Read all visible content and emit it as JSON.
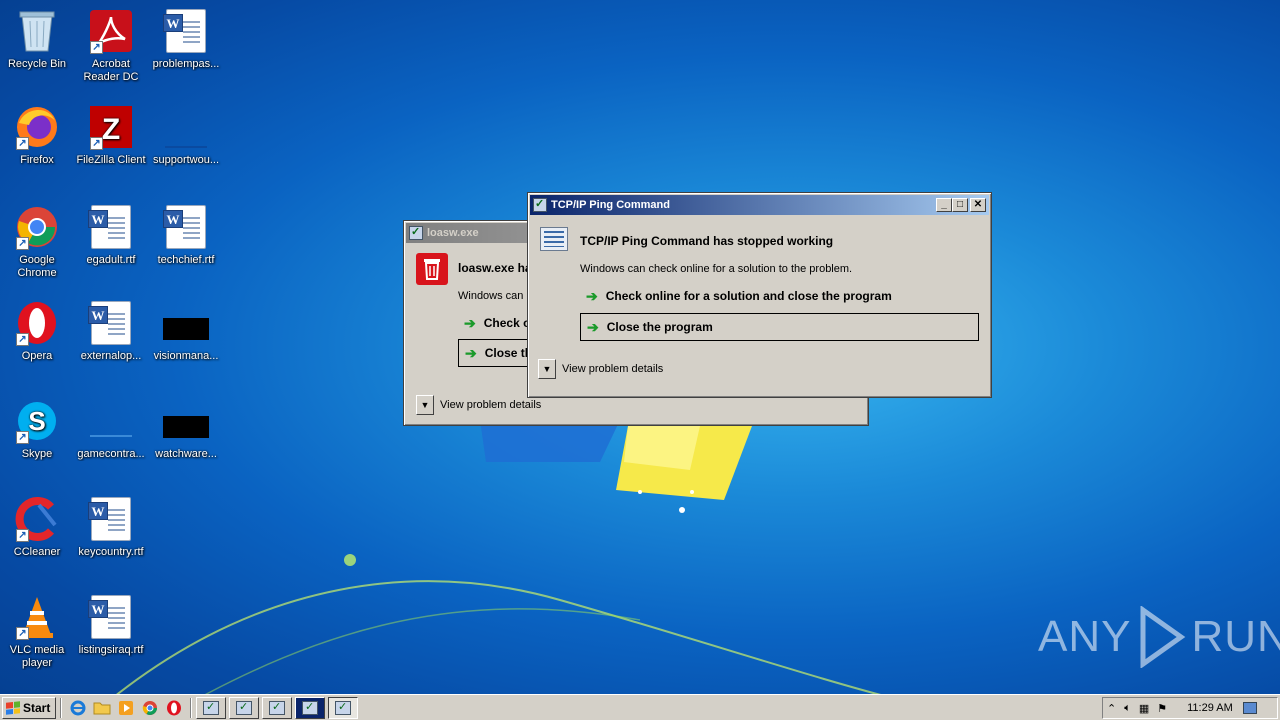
{
  "desktop": {
    "icons": [
      {
        "label": "Recycle Bin",
        "icon": "recycle-bin-icon"
      },
      {
        "label": "Acrobat Reader DC",
        "icon": "acrobat-icon"
      },
      {
        "label": "problempas...",
        "icon": "word-doc-icon"
      },
      {
        "label": "Firefox",
        "icon": "firefox-icon"
      },
      {
        "label": "FileZilla Client",
        "icon": "filezilla-icon"
      },
      {
        "label": "supportwou...",
        "icon": "blank-file-icon"
      },
      {
        "label": "Google Chrome",
        "icon": "chrome-icon"
      },
      {
        "label": "egadult.rtf",
        "icon": "word-doc-icon"
      },
      {
        "label": "techchief.rtf",
        "icon": "word-doc-icon"
      },
      {
        "label": "Opera",
        "icon": "opera-icon"
      },
      {
        "label": "externalop...",
        "icon": "word-doc-icon"
      },
      {
        "label": "visionmana...",
        "icon": "black-file-icon"
      },
      {
        "label": "Skype",
        "icon": "skype-icon"
      },
      {
        "label": "gamecontra...",
        "icon": "blank-file-icon"
      },
      {
        "label": "watchware...",
        "icon": "black-file-icon"
      },
      {
        "label": "CCleaner",
        "icon": "ccleaner-icon"
      },
      {
        "label": "keycountry.rtf",
        "icon": "word-doc-icon"
      },
      {
        "label": "VLC media player",
        "icon": "vlc-icon"
      },
      {
        "label": "listingsiraq.rtf",
        "icon": "word-doc-icon"
      }
    ]
  },
  "dialog_back": {
    "title": "loasw.exe",
    "heading": "loasw.exe ha",
    "subtext": "Windows can c",
    "option1": "Check o",
    "option2": "Close th",
    "details": "View problem details"
  },
  "dialog_front": {
    "title": "TCP/IP Ping Command",
    "heading": "TCP/IP Ping Command has stopped working",
    "subtext": "Windows can check online for a solution to the problem.",
    "option1": "Check online for a solution and close the program",
    "option2": "Close the program",
    "details": "View problem details",
    "min": "_",
    "max": "□",
    "close": "✕"
  },
  "taskbar": {
    "start": "Start",
    "clock": "11:29 AM"
  },
  "watermark": {
    "left": "ANY",
    "right": "RUN"
  }
}
